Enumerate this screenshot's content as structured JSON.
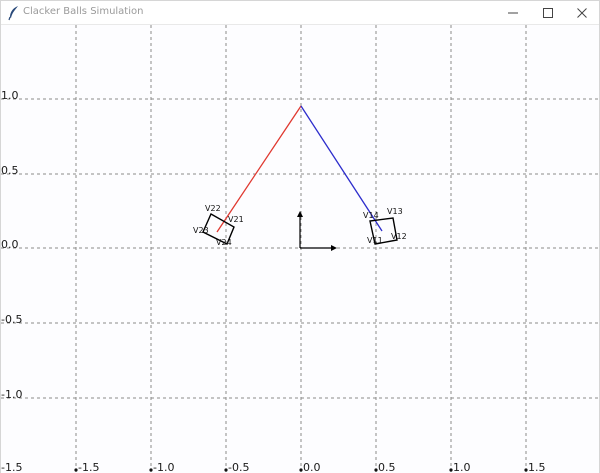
{
  "window": {
    "title": "Clacker Balls Simulation",
    "app_icon": "feather-icon",
    "controls": {
      "minimize": "minimize-icon",
      "maximize": "maximize-icon",
      "close": "close-icon"
    }
  },
  "canvas": {
    "background": "#fdfdff",
    "grid_color": "#8a8a8a",
    "grid": true,
    "x_ticks": [
      "-1.5",
      "-1.0",
      "-0.5",
      "0.0",
      "0.5",
      "1.0",
      "1.5"
    ],
    "y_ticks": [
      "1.0",
      "0.5",
      "0.0",
      "-0.5",
      "-1.0",
      "-1.5"
    ],
    "pivot": {
      "x": 0.0,
      "y": 0.95
    },
    "left_string_color": "#e0382f",
    "right_string_color": "#2d2dcc",
    "left_box": {
      "center": {
        "x": -0.57,
        "y": 0.12
      },
      "labels": [
        "V21",
        "V22",
        "V23",
        "V24"
      ]
    },
    "right_box": {
      "center": {
        "x": 0.55,
        "y": 0.1
      },
      "labels": [
        "V11",
        "V12",
        "V13",
        "V14"
      ]
    },
    "axes_arrows": {
      "origin": {
        "x": 0.0,
        "y": 0.0
      },
      "length": 0.23
    }
  }
}
